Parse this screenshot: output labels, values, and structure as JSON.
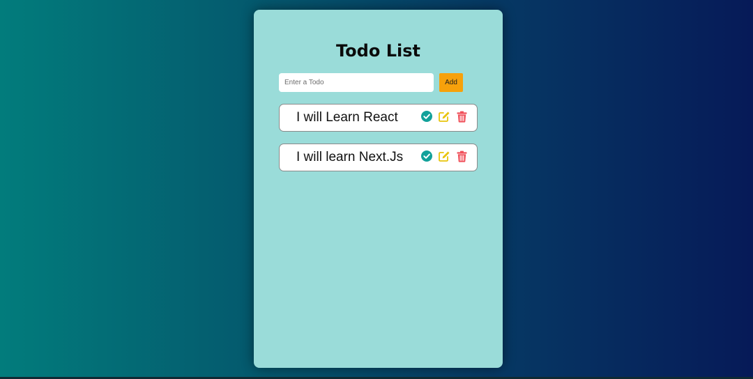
{
  "app": {
    "title": "Todo List"
  },
  "form": {
    "input_value": "",
    "input_placeholder": "Enter a Todo",
    "add_label": "Add"
  },
  "todos": [
    {
      "text": "I will Learn React"
    },
    {
      "text": "I will learn Next.Js"
    }
  ],
  "icons": {
    "complete": "check-circle-icon",
    "edit": "edit-icon",
    "delete": "trash-icon"
  },
  "colors": {
    "card_background": "#9adcd9",
    "add_button": "#f7a10b",
    "complete_icon": "#12a19a",
    "edit_icon": "#e8c40c",
    "delete_icon": "#f0505a"
  }
}
